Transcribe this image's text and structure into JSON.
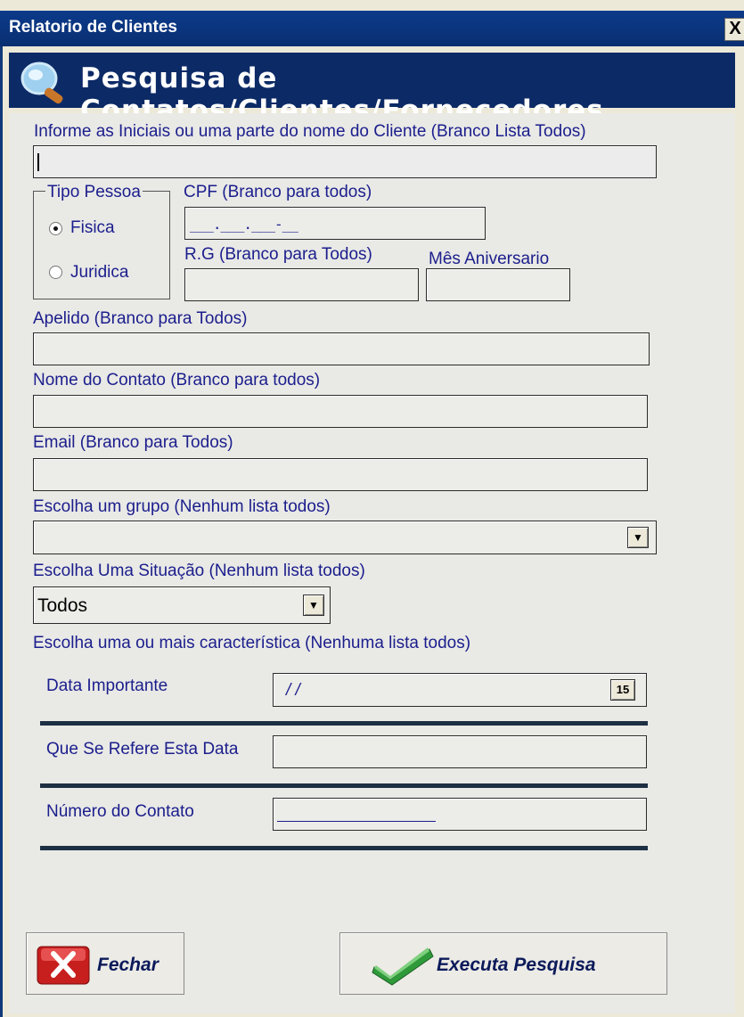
{
  "window": {
    "title": "Relatorio de Clientes",
    "close_label": "X"
  },
  "header": {
    "title": "Pesquisa de Contatos/Clientes/Fornecedores",
    "icon": "search-magnifier-icon"
  },
  "form": {
    "name_label": "Informe as Iniciais ou uma parte do nome do Cliente (Branco Lista Todos)",
    "name_value": "",
    "tipo_pessoa": {
      "legend": "Tipo Pessoa",
      "options": [
        "Fisica",
        "Juridica"
      ],
      "selected": "Fisica"
    },
    "cpf_label": "CPF (Branco para todos)",
    "cpf_mask": "___.___.___-__",
    "rg_label": "R.G (Branco para Todos)",
    "mes_label": "Mês Aniversario",
    "apelido_label": "Apelido (Branco para Todos)",
    "contato_label": "Nome do Contato (Branco para todos)",
    "email_label": "Email (Branco para Todos)",
    "grupo_label": "Escolha um grupo (Nenhum lista todos)",
    "grupo_value": "",
    "situacao_label": "Escolha Uma Situação (Nenhum lista todos)",
    "situacao_value": "Todos",
    "caracteristica_label": "Escolha uma ou mais característica (Nenhuma lista todos)",
    "data_importante_label": "Data Importante",
    "data_importante_value": "/ /",
    "calendar_label": "15",
    "refere_label": "Que Se Refere Esta Data",
    "numero_label": "Número do Contato"
  },
  "buttons": {
    "fechar": "Fechar",
    "executa": "Executa Pesquisa"
  },
  "colors": {
    "title_bar": "#0b3a8a",
    "header": "#0c2a66",
    "label_text": "#1b1e8c",
    "panel": "#e9e9e6"
  }
}
